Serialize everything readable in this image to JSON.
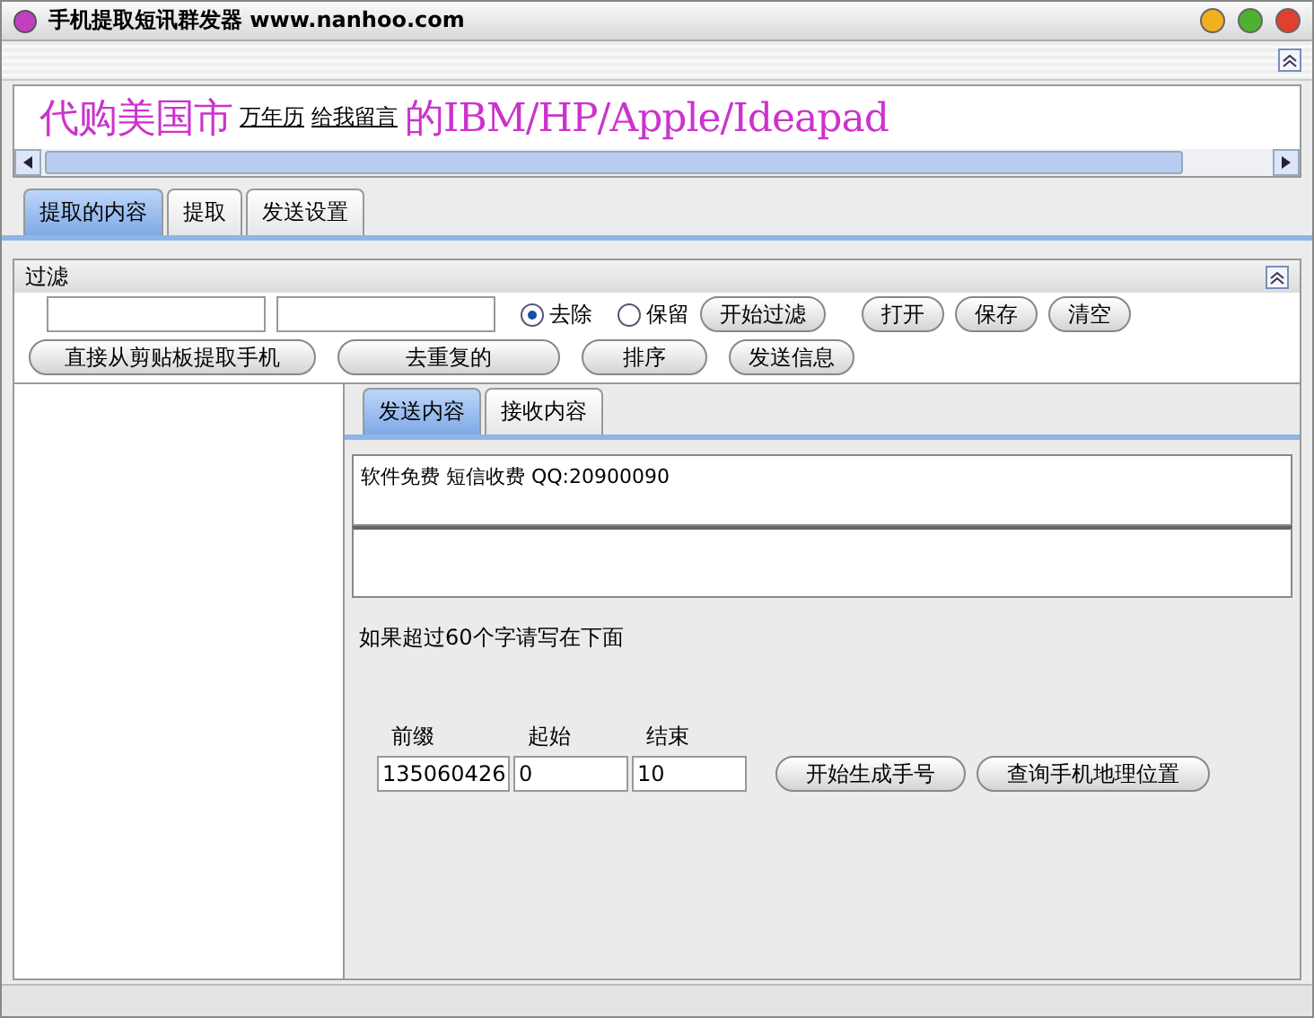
{
  "window": {
    "title": "手机提取短讯群发器 www.nanhoo.com"
  },
  "banner": {
    "text_before": "代购美国市",
    "links": [
      "万年历",
      "给我留言"
    ],
    "text_after": "的IBM/HP/Apple/Ideapad"
  },
  "tabs": [
    {
      "label": "提取的内容",
      "selected": true
    },
    {
      "label": "提取",
      "selected": false
    },
    {
      "label": "发送设置",
      "selected": false
    }
  ],
  "filter": {
    "title": "过滤",
    "options": [
      {
        "label": "去除",
        "selected": true
      },
      {
        "label": "保留",
        "selected": false
      }
    ],
    "start_button": "开始过滤",
    "file_buttons": [
      "打开",
      "保存",
      "清空"
    ],
    "actions": [
      "直接从剪贴板提取手机",
      "去重复的",
      "排序",
      "发送信息"
    ]
  },
  "message_tabs": [
    {
      "label": "发送内容",
      "selected": true
    },
    {
      "label": "接收内容",
      "selected": false
    }
  ],
  "message": {
    "text": "软件免费 短信收费 QQ:20900090"
  },
  "hint": "如果超过60个字请写在下面",
  "generator": {
    "fields": [
      {
        "label": "前缀",
        "value": "135060426"
      },
      {
        "label": "起始",
        "value": "0"
      },
      {
        "label": "结束",
        "value": "10"
      }
    ],
    "buttons": [
      "开始生成手号",
      "查询手机地理位置"
    ]
  }
}
